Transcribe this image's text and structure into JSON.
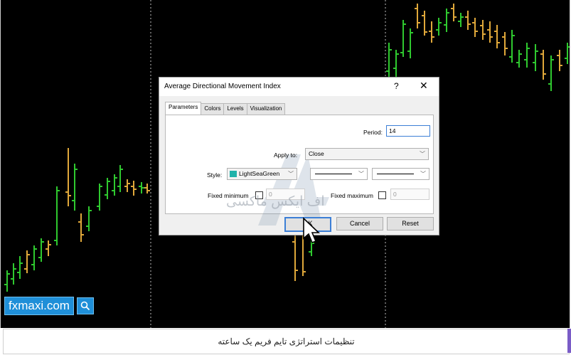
{
  "watermark": {
    "site": "fxmaxi.com",
    "icon": "search-icon",
    "overlay_text": "اف ایکس ماکسی"
  },
  "dialog": {
    "title": "Average Directional Movement Index",
    "help_label": "?",
    "close_label": "✕",
    "tabs": [
      {
        "label": "Parameters",
        "active": true
      },
      {
        "label": "Colors",
        "active": false
      },
      {
        "label": "Levels",
        "active": false
      },
      {
        "label": "Visualization",
        "active": false
      }
    ],
    "period": {
      "label": "Period:",
      "value": "14"
    },
    "apply_to": {
      "label": "Apply to:",
      "value": "Close"
    },
    "style": {
      "label": "Style:",
      "color_name": "LightSeaGreen",
      "color_hex": "#20b2aa"
    },
    "fixed_minimum": {
      "label": "Fixed minimum",
      "value": "0"
    },
    "fixed_maximum": {
      "label": "Fixed maximum",
      "value": "0"
    },
    "buttons": {
      "ok": "OK",
      "cancel": "Cancel",
      "reset": "Reset"
    }
  },
  "caption": "تنظیمات استراتژی تایم فریم یک ساعته",
  "colors": {
    "bull_bar": "#2fc92f",
    "bear_bar": "#e0a83a",
    "chart_bg": "#000000",
    "brand": "#1f8fd8"
  }
}
